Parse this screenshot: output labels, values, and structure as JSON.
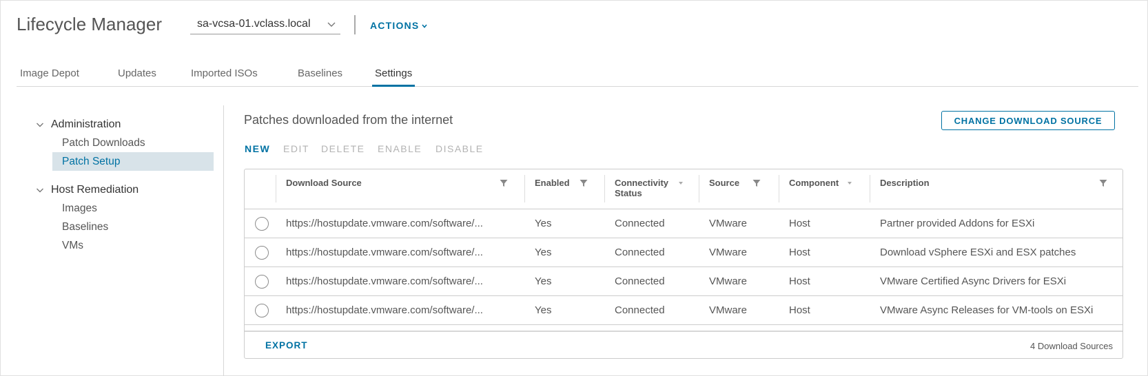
{
  "header": {
    "title": "Lifecycle Manager",
    "vcenter_selected": "sa-vcsa-01.vclass.local",
    "actions_label": "ACTIONS"
  },
  "tabs": [
    {
      "label": "Image Depot",
      "active": false
    },
    {
      "label": "Updates",
      "active": false
    },
    {
      "label": "Imported ISOs",
      "active": false
    },
    {
      "label": "Baselines",
      "active": false
    },
    {
      "label": "Settings",
      "active": true
    }
  ],
  "sidebar": {
    "groups": [
      {
        "label": "Administration",
        "expanded": true,
        "items": [
          {
            "label": "Patch Downloads",
            "active": false
          },
          {
            "label": "Patch Setup",
            "active": true
          }
        ]
      },
      {
        "label": "Host Remediation",
        "expanded": true,
        "items": [
          {
            "label": "Images",
            "active": false
          },
          {
            "label": "Baselines",
            "active": false
          },
          {
            "label": "VMs",
            "active": false
          }
        ]
      }
    ]
  },
  "main": {
    "section_title": "Patches downloaded from the internet",
    "change_source_label": "CHANGE DOWNLOAD SOURCE",
    "toolbar": {
      "new": "NEW",
      "edit": "EDIT",
      "delete": "DELETE",
      "enable": "ENABLE",
      "disable": "DISABLE"
    },
    "grid": {
      "columns": {
        "download_source": "Download Source",
        "enabled": "Enabled",
        "connectivity_line1": "Connectivity",
        "connectivity_line2": "Status",
        "source": "Source",
        "component": "Component",
        "description": "Description"
      },
      "rows": [
        {
          "download_source": "https://hostupdate.vmware.com/software/...",
          "enabled": "Yes",
          "connectivity": "Connected",
          "source": "VMware",
          "component": "Host",
          "description": "Partner provided Addons for ESXi"
        },
        {
          "download_source": "https://hostupdate.vmware.com/software/...",
          "enabled": "Yes",
          "connectivity": "Connected",
          "source": "VMware",
          "component": "Host",
          "description": "Download vSphere ESXi and ESX patches"
        },
        {
          "download_source": "https://hostupdate.vmware.com/software/...",
          "enabled": "Yes",
          "connectivity": "Connected",
          "source": "VMware",
          "component": "Host",
          "description": "VMware Certified Async Drivers for ESXi"
        },
        {
          "download_source": "https://hostupdate.vmware.com/software/...",
          "enabled": "Yes",
          "connectivity": "Connected",
          "source": "VMware",
          "component": "Host",
          "description": "VMware Async Releases for VM-tools on ESXi"
        }
      ],
      "export_label": "EXPORT",
      "count_label": "4 Download Sources"
    }
  },
  "colors": {
    "accent": "#0072a3",
    "selected_bg": "#d8e3e9",
    "disabled_text": "#b3b3b3"
  }
}
